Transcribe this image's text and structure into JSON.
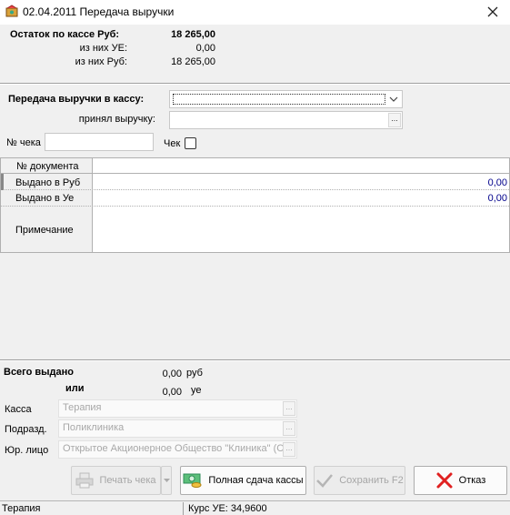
{
  "window": {
    "title": "02.04.2011 Передача выручки"
  },
  "balance": {
    "label": "Остаток по кассе Руб:",
    "value": "18 265,00",
    "ue_label": "из них УЕ:",
    "ue_value": "0,00",
    "rub_label": "из них Руб:",
    "rub_value": "18 265,00"
  },
  "transfer": {
    "label": "Передача выручки в кассу:",
    "combo_value": "",
    "accepted_label": "принял выручку:",
    "accepted_value": "",
    "ellipsis": "..."
  },
  "receipt": {
    "number_label": "№ чека",
    "number_value": "",
    "check_label": "Чек",
    "check_checked": false
  },
  "grid": {
    "doc_label": "№ документа",
    "doc_value": "",
    "rub_label": "Выдано в Руб",
    "rub_value": "0,00",
    "ue_label": "Выдано в Уе",
    "ue_value": "0,00",
    "note_label": "Примечание",
    "note_value": ""
  },
  "totals": {
    "label": "Всего выдано",
    "rub_value": "0,00",
    "rub_unit": "руб",
    "or_label": "или",
    "ue_value": "0,00",
    "ue_unit": "уе"
  },
  "fields": {
    "kassa_label": "Касса",
    "kassa_value": "Терапия",
    "podrazd_label": "Подразд.",
    "podrazd_value": "Поликлиника",
    "jur_label": "Юр. лицо",
    "jur_value": "Открытое Акционерное Общество \"Клиника\" (С"
  },
  "buttons": {
    "print": "Печать чека",
    "full": "Полная сдача кассы",
    "save": "Сохранить F2",
    "cancel": "Отказ"
  },
  "status": {
    "left": "Терапия",
    "right": "Курс УЕ: 34,9600"
  },
  "colors": {
    "value_blue": "#00008b",
    "cancel_red": "#e02020",
    "money_green": "#2e8b57"
  }
}
